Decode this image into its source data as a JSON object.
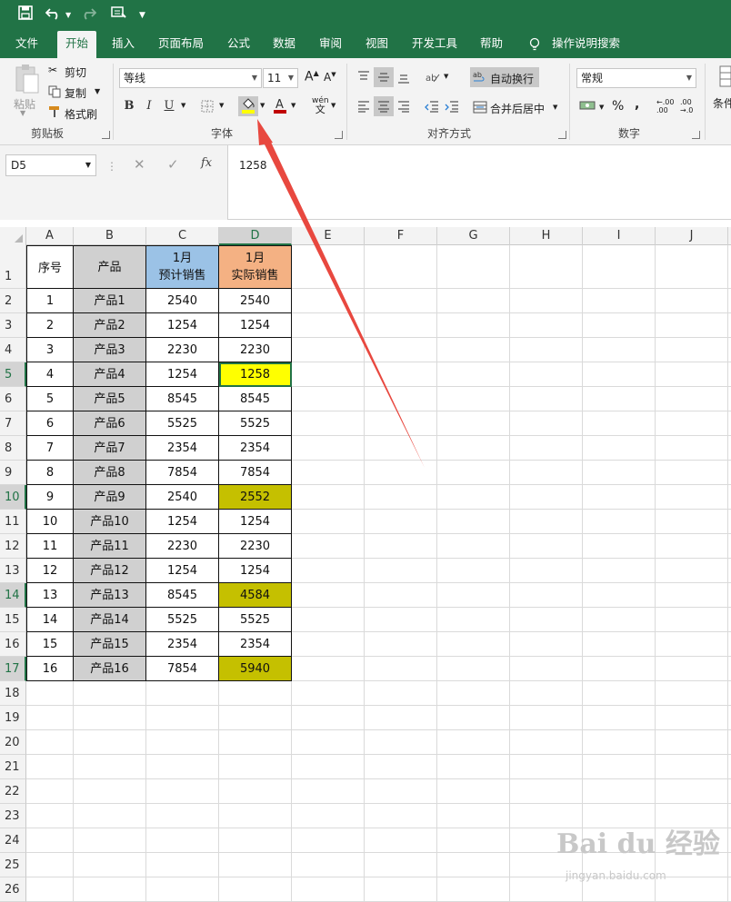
{
  "qat": {
    "save_icon": "save-icon",
    "undo_icon": "undo-icon",
    "redo_icon": "redo-icon",
    "touch_icon": "touch-mode-icon",
    "customize_icon": "customize-qat-icon"
  },
  "tabs": [
    "文件",
    "开始",
    "插入",
    "页面布局",
    "公式",
    "数据",
    "审阅",
    "视图",
    "开发工具",
    "帮助"
  ],
  "active_tab": "开始",
  "tell_me": "操作说明搜索",
  "ribbon": {
    "clipboard": {
      "paste": "粘贴",
      "cut": "剪切",
      "copy": "复制",
      "format_painter": "格式刷",
      "label": "剪贴板"
    },
    "font": {
      "name": "等线",
      "size": "11",
      "bold": "B",
      "italic": "I",
      "underline": "U",
      "grow": "A",
      "shrink": "A",
      "wen": "wén",
      "wen2": "文",
      "label": "字体"
    },
    "alignment": {
      "wrap": "自动换行",
      "merge": "合并后居中",
      "label": "对齐方式"
    },
    "number": {
      "format": "常规",
      "percent": "%",
      "comma": ",",
      "inc_dec": ".00",
      "label": "数字"
    },
    "styles": {
      "conditional": "条件"
    }
  },
  "formula_bar": {
    "name_box": "D5",
    "value": "1258",
    "fx": "fx"
  },
  "colors": {
    "brand": "#217346",
    "header_c": "#9bc2e6",
    "header_d": "#f4b183",
    "product_col": "#d0d0d0",
    "yellow": "#ffff00",
    "olive": "#c5c000",
    "arrow": "#e8483f"
  },
  "columns": [
    "A",
    "B",
    "C",
    "D",
    "E",
    "F",
    "G",
    "H",
    "I",
    "J"
  ],
  "selected_column": "D",
  "rows": [
    "1",
    "2",
    "3",
    "4",
    "5",
    "6",
    "7",
    "8",
    "9",
    "10",
    "11",
    "12",
    "13",
    "14",
    "15",
    "16",
    "17",
    "18",
    "19",
    "20",
    "21",
    "22",
    "23",
    "24",
    "25",
    "26"
  ],
  "selected_rows": [
    "5",
    "10",
    "14",
    "17"
  ],
  "table": {
    "header": {
      "a": "序号",
      "b": "产品",
      "c1": "1月",
      "c2": "预计销售",
      "d1": "1月",
      "d2": "实际销售"
    },
    "data": [
      {
        "a": "1",
        "b": "产品1",
        "c": "2540",
        "d": "2540",
        "hl": ""
      },
      {
        "a": "2",
        "b": "产品2",
        "c": "1254",
        "d": "1254",
        "hl": ""
      },
      {
        "a": "3",
        "b": "产品3",
        "c": "2230",
        "d": "2230",
        "hl": ""
      },
      {
        "a": "4",
        "b": "产品4",
        "c": "1254",
        "d": "1258",
        "hl": "yellow"
      },
      {
        "a": "5",
        "b": "产品5",
        "c": "8545",
        "d": "8545",
        "hl": ""
      },
      {
        "a": "6",
        "b": "产品6",
        "c": "5525",
        "d": "5525",
        "hl": ""
      },
      {
        "a": "7",
        "b": "产品7",
        "c": "2354",
        "d": "2354",
        "hl": ""
      },
      {
        "a": "8",
        "b": "产品8",
        "c": "7854",
        "d": "7854",
        "hl": ""
      },
      {
        "a": "9",
        "b": "产品9",
        "c": "2540",
        "d": "2552",
        "hl": "olive"
      },
      {
        "a": "10",
        "b": "产品10",
        "c": "1254",
        "d": "1254",
        "hl": ""
      },
      {
        "a": "11",
        "b": "产品11",
        "c": "2230",
        "d": "2230",
        "hl": ""
      },
      {
        "a": "12",
        "b": "产品12",
        "c": "1254",
        "d": "1254",
        "hl": ""
      },
      {
        "a": "13",
        "b": "产品13",
        "c": "8545",
        "d": "4584",
        "hl": "olive"
      },
      {
        "a": "14",
        "b": "产品14",
        "c": "5525",
        "d": "5525",
        "hl": ""
      },
      {
        "a": "15",
        "b": "产品15",
        "c": "2354",
        "d": "2354",
        "hl": ""
      },
      {
        "a": "16",
        "b": "产品16",
        "c": "7854",
        "d": "5940",
        "hl": "olive"
      }
    ]
  },
  "watermark": {
    "logo": "Bai du 经验",
    "url": "jingyan.baidu.com"
  }
}
